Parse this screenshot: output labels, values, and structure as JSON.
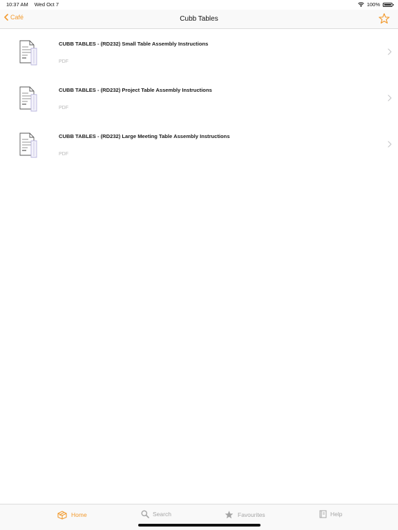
{
  "status": {
    "time": "10:37 AM",
    "date": "Wed Oct 7",
    "battery": "100%"
  },
  "nav": {
    "back_label": "Café",
    "title": "Cubb Tables",
    "favourite_icon": "star-outline-icon"
  },
  "documents": [
    {
      "title": "CUBB TABLES - (RD232) Small Table Assembly Instructions",
      "type": "PDF"
    },
    {
      "title": "CUBB TABLES - (RD232) Project Table Assembly Instructions",
      "type": "PDF"
    },
    {
      "title": "CUBB TABLES - (RD232) Large Meeting Table Assembly Instructions",
      "type": "PDF"
    }
  ],
  "tabs": [
    {
      "label": "Home",
      "icon": "home-box-icon",
      "active": true
    },
    {
      "label": "Search",
      "icon": "search-icon",
      "active": false
    },
    {
      "label": "Favourites",
      "icon": "star-icon",
      "active": false
    },
    {
      "label": "Help",
      "icon": "book-icon",
      "active": false
    }
  ],
  "colors": {
    "accent": "#f29a2e",
    "inactive": "#a5a5a5"
  }
}
